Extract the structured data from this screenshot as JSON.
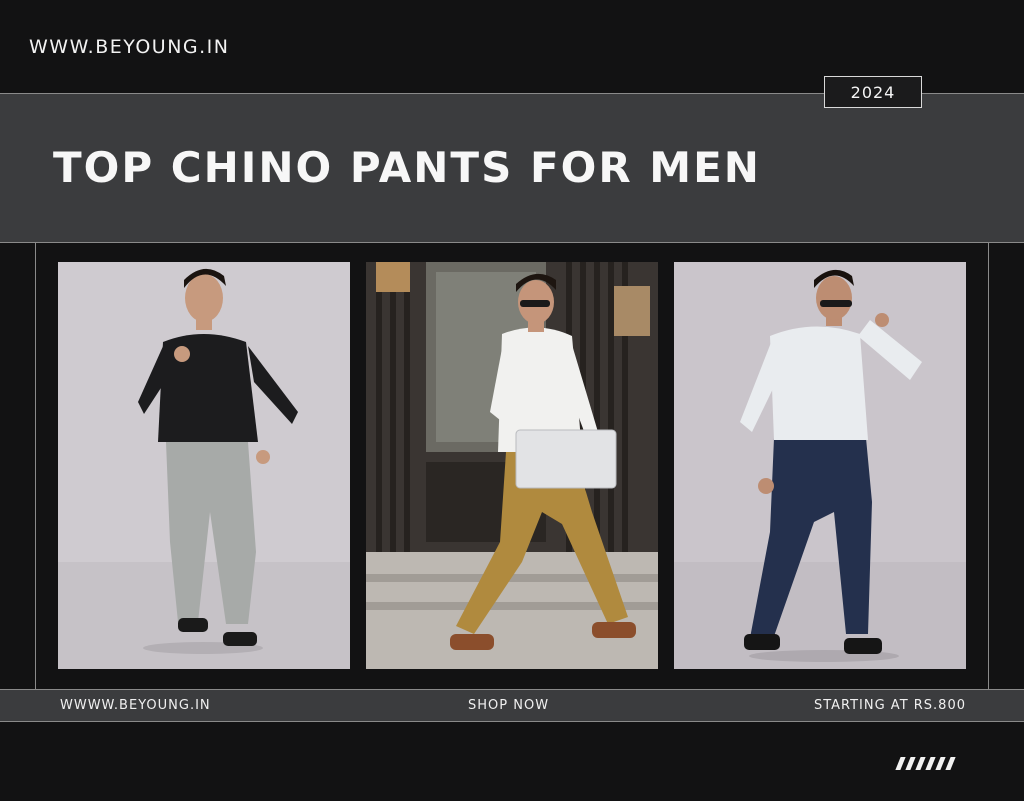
{
  "header": {
    "site_url": "WWW.BEYOUNG.IN",
    "year": "2024"
  },
  "hero": {
    "title": "TOP CHINO PANTS FOR MEN"
  },
  "gallery": {
    "photos": [
      {
        "name": "model-black-shirt-grey-chinos",
        "shirt_color": "#1c1c1e",
        "pants_color": "#a7aaa8"
      },
      {
        "name": "model-white-shirt-khaki-chinos",
        "shirt_color": "#f1f1ef",
        "pants_color": "#b08a3e"
      },
      {
        "name": "model-white-shirt-navy-chinos",
        "shirt_color": "#e9ecef",
        "pants_color": "#24304d"
      }
    ]
  },
  "footer": {
    "url": "WWWW.BEYOUNG.IN",
    "cta": "SHOP NOW",
    "price": "STARTING AT RS.800"
  },
  "decor": {
    "icon": "slash-stripes-icon"
  },
  "colors": {
    "background": "#121213",
    "band": "#3b3c3e",
    "accent_line": "#8a8a8a"
  }
}
